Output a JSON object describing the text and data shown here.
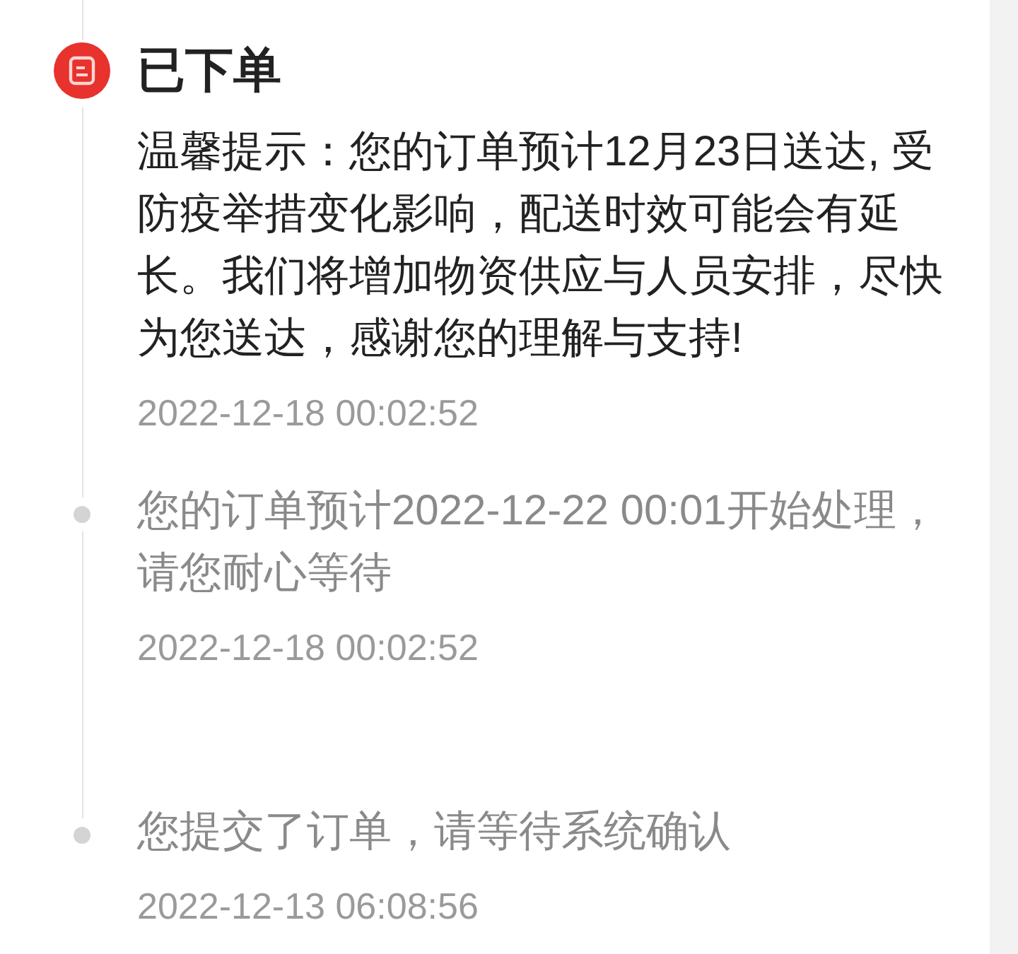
{
  "timeline": [
    {
      "kind": "current",
      "title": "已下单",
      "message": "温馨提示：您的订单预计12月23日送达, 受防疫举措变化影响，配送时效可能会有延长。我们将增加物资供应与人员安排，尽快为您送达，感谢您的理解与支持!",
      "time": "2022-12-18 00:02:52"
    },
    {
      "kind": "past",
      "message": "您的订单预计2022-12-22 00:01开始处理，请您耐心等待",
      "time": "2022-12-18 00:02:52"
    },
    {
      "kind": "past",
      "message": "您提交了订单，请等待系统确认",
      "time": "2022-12-13 06:08:56"
    }
  ]
}
